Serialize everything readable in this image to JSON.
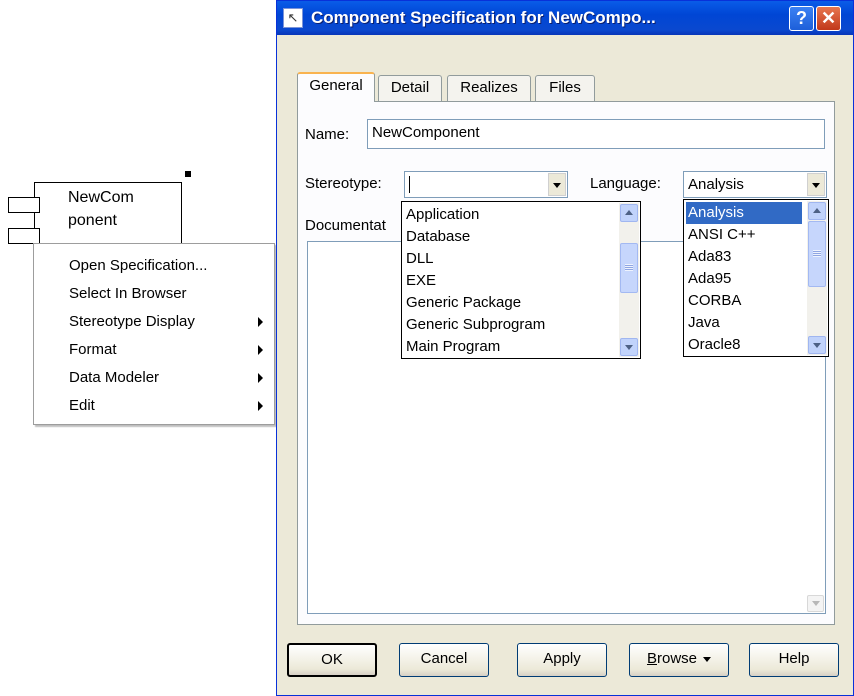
{
  "diagram": {
    "component_label_line1": "NewCom",
    "component_label_line2": "ponent"
  },
  "context_menu": {
    "items": [
      {
        "label": "Open Specification...",
        "submenu": false
      },
      {
        "label": "Select In Browser",
        "submenu": false
      },
      {
        "label": "Stereotype Display",
        "submenu": true
      },
      {
        "label": "Format",
        "submenu": true
      },
      {
        "label": "Data Modeler",
        "submenu": true
      },
      {
        "label": "Edit",
        "submenu": true
      }
    ]
  },
  "dialog": {
    "title": "Component Specification for NewCompo...",
    "title_icon": "rose-spec-icon",
    "help_button": "?",
    "close_button": "✕",
    "tabs": [
      "General",
      "Detail",
      "Realizes",
      "Files"
    ],
    "active_tab": "General",
    "name_label": "Name:",
    "name_value": "NewComponent",
    "stereotype_label": "Stereotype:",
    "stereotype_value": "",
    "language_label": "Language:",
    "language_value": "Analysis",
    "documentation_label": "Documentat",
    "stereotype_options": [
      "Application",
      "Database",
      "DLL",
      "EXE",
      "Generic Package",
      "Generic Subprogram",
      "Main Program"
    ],
    "language_options": [
      "Analysis",
      "ANSI C++",
      "Ada83",
      "Ada95",
      "CORBA",
      "Java",
      "Oracle8"
    ],
    "language_selected": "Analysis",
    "buttons": {
      "ok": "OK",
      "cancel": "Cancel",
      "apply": "Apply",
      "browse_first": "B",
      "browse_rest": "rowse",
      "help": "Help"
    }
  },
  "colors": {
    "titlebar": "#0046d5",
    "dialog_face": "#ece9d8",
    "selection": "#316ac5"
  }
}
